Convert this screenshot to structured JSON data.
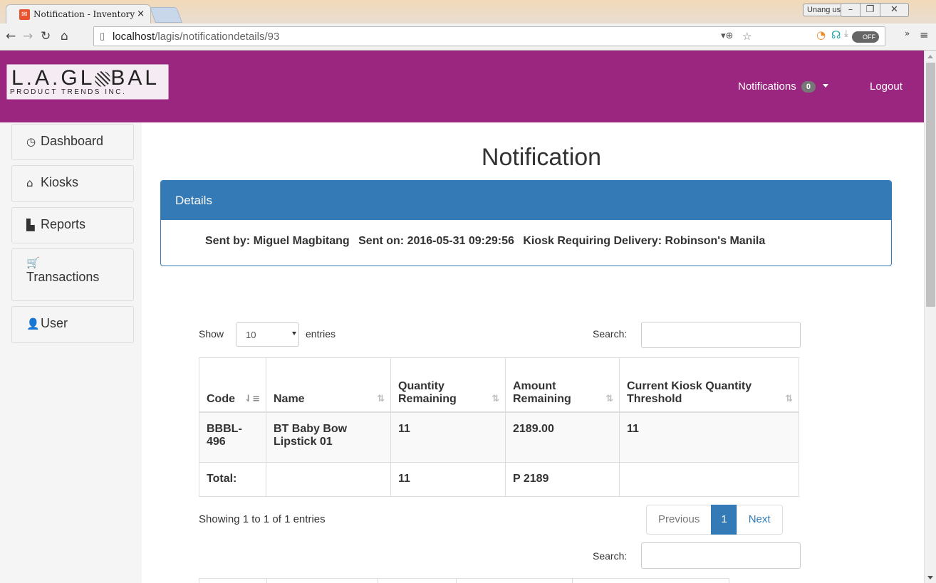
{
  "browser": {
    "tab_title": "Notification - Inventory Sy",
    "tab_close": "×",
    "profile_label": "Unang user",
    "url_host": "localhost",
    "url_path": "/lagis/notificationdetails/93",
    "win_minimize": "–",
    "win_maximize": "❐",
    "win_close": "✕"
  },
  "navbar": {
    "logo_main": "L.A.GL",
    "logo_main_tail": "BAL",
    "logo_sub": "PRODUCT TRENDS INC.",
    "notifications_label": "Notifications",
    "notifications_count": "0",
    "logout_label": "Logout",
    "bg_color": "#9b2680"
  },
  "sidebar": {
    "items": [
      {
        "label": "Dashboard",
        "icon": "dashboard-icon"
      },
      {
        "label": "Kiosks",
        "icon": "home-icon"
      },
      {
        "label": "Reports",
        "icon": "file-icon"
      },
      {
        "label": "Transactions",
        "icon": "cart-icon"
      },
      {
        "label": "User",
        "icon": "user-icon"
      }
    ]
  },
  "main": {
    "title": "Notification",
    "panel_heading": "Details",
    "sent_by": "Sent by: Miguel Magbitang",
    "sent_on": "Sent on: 2016-05-31 09:29:56",
    "kiosk": "Kiosk Requiring Delivery: Robinson's Manila"
  },
  "datatable": {
    "show_label": "Show",
    "entries_value": "10",
    "entries_label": "entries",
    "search_label": "Search:",
    "search_value": "",
    "columns": [
      "Code",
      "Name",
      "Quantity Remaining",
      "Amount Remaining",
      "Current Kiosk Quantity Threshold"
    ],
    "rows": [
      {
        "code": "BBBL-496",
        "name": "BT Baby Bow Lipstick 01",
        "qty": "11",
        "amount": "2189.00",
        "threshold": "11"
      }
    ],
    "footer": {
      "label": "Total:",
      "name": "",
      "qty": "11",
      "amount": "P 2189",
      "threshold": ""
    },
    "info": "Showing 1 to 1 of 1 entries",
    "pager": {
      "previous": "Previous",
      "page": "1",
      "next": "Next"
    }
  },
  "colors": {
    "primary": "#337ab7",
    "brand": "#9b2680"
  }
}
